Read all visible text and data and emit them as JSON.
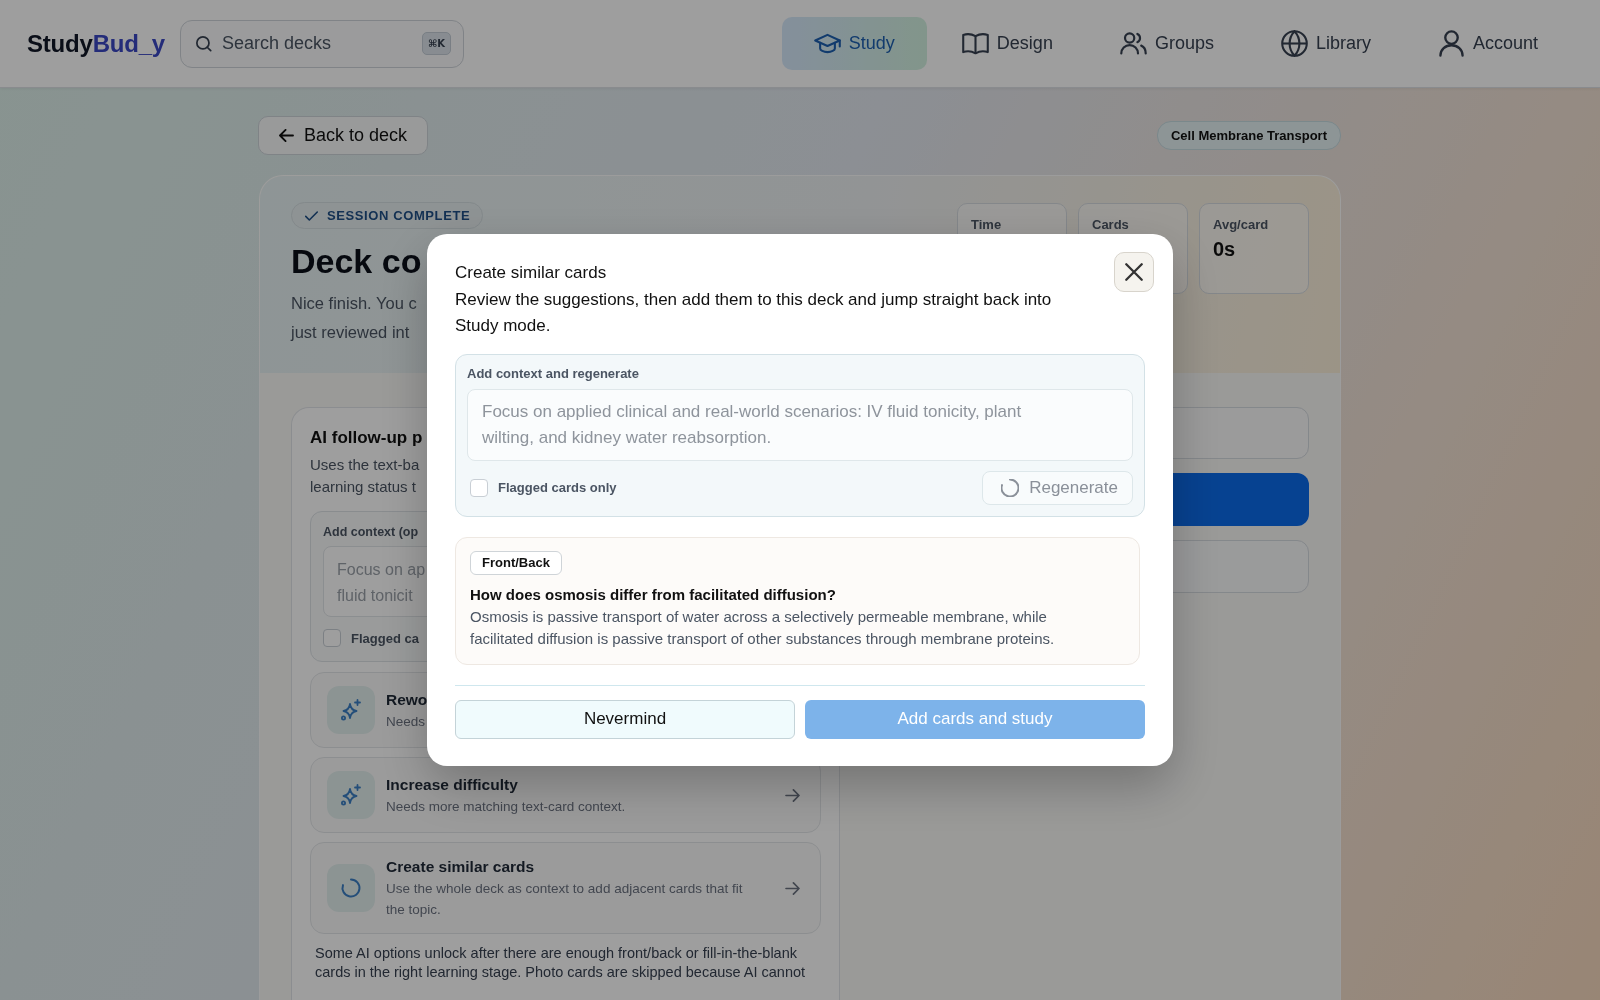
{
  "header": {
    "logo": {
      "primary": "Study",
      "accent": "Bud_y"
    },
    "search": {
      "placeholder": "Search decks",
      "shortcut": "⌘K"
    },
    "nav": [
      {
        "label": "Study",
        "kind": "study",
        "selected": true
      },
      {
        "label": "Design",
        "kind": "design",
        "selected": false
      },
      {
        "label": "Groups",
        "kind": "groups",
        "selected": false
      },
      {
        "label": "Library",
        "kind": "library",
        "selected": false
      },
      {
        "label": "Account",
        "kind": "account",
        "selected": false
      }
    ]
  },
  "toolbar": {
    "back_button": "Back to deck",
    "deck_tag": "Cell Membrane Transport"
  },
  "hero": {
    "status": "SESSION COMPLETE",
    "title": "Deck co",
    "summary_lines": [
      "Nice finish. You c",
      "just reviewed int"
    ],
    "stats": [
      {
        "label": "Time"
      },
      {
        "label": "Cards"
      },
      {
        "label": "Avg/card",
        "value": "0s"
      }
    ]
  },
  "ai_panel": {
    "title": "AI follow-up p",
    "description_lines": [
      "Uses the text-ba",
      "learning status t"
    ],
    "context": {
      "label": "Add context (op",
      "placeholder": "Focus on ap\nfluid tonicit",
      "flagged_label": "Flagged ca",
      "flagged_checked": false
    },
    "options": [
      {
        "kind": "rewrite",
        "title": "Rewo",
        "description": "Needs"
      },
      {
        "kind": "rewrite",
        "title": "Increase difficulty",
        "description": "Needs more matching text-card context.",
        "arrow": true
      },
      {
        "kind": "generate",
        "title": "Create similar cards",
        "description": "Use the whole deck as context to add adjacent cards that fit the topic.",
        "arrow": true
      }
    ],
    "note": "Some AI options unlock after there are enough front/back or fill-in-the-blank cards in the right learning stage. Photo cards are skipped because AI cannot"
  },
  "modal": {
    "title": "Create similar cards",
    "description": "Review the suggestions, then add them to this deck and jump straight back into Study mode.",
    "context": {
      "label": "Add context and regenerate",
      "placeholder": "Focus on applied clinical and real-world scenarios: IV fluid tonicity, plant wilting, and kidney water reabsorption.",
      "flagged_label": "Flagged cards only",
      "flagged_checked": false,
      "regenerate": {
        "label": "Regenerate",
        "disabled": true
      }
    },
    "suggestions": [
      {
        "type": "Front/Back",
        "question": "How does osmosis differ from facilitated diffusion?",
        "answer": "Osmosis is passive transport of water across a selectively permeable membrane, while facilitated diffusion is passive transport of other substances through membrane proteins."
      }
    ],
    "buttons": [
      {
        "label": "Nevermind",
        "kind": "secondary",
        "disabled": false
      },
      {
        "label": "Add cards and study",
        "kind": "primary",
        "disabled": true
      }
    ]
  }
}
